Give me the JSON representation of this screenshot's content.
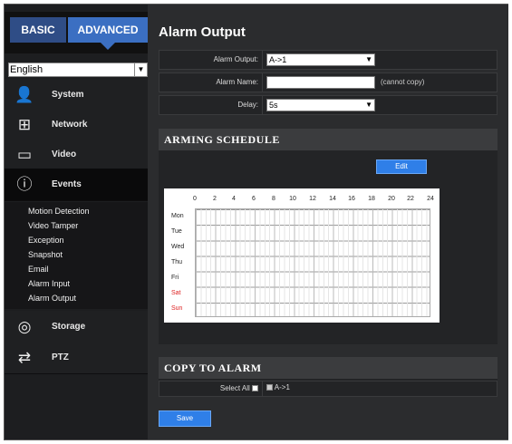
{
  "tabs": {
    "basic": "BASIC",
    "advanced": "ADVANCED"
  },
  "language": {
    "selected": "English"
  },
  "nav": {
    "system": "System",
    "network": "Network",
    "video": "Video",
    "events": "Events",
    "storage": "Storage",
    "ptz": "PTZ"
  },
  "events_submenu": [
    "Motion Detection",
    "Video Tamper",
    "Exception",
    "Snapshot",
    "Email",
    "Alarm Input",
    "Alarm Output"
  ],
  "page": {
    "title": "Alarm Output"
  },
  "form": {
    "alarm_output_label": "Alarm Output:",
    "alarm_output_value": "A->1",
    "alarm_name_label": "Alarm Name:",
    "alarm_name_value": "",
    "alarm_name_note": "(cannot copy)",
    "delay_label": "Delay:",
    "delay_value": "5s"
  },
  "schedule": {
    "title": "ARMING SCHEDULE",
    "edit_label": "Edit",
    "hours": [
      "0",
      "2",
      "4",
      "6",
      "8",
      "10",
      "12",
      "14",
      "16",
      "18",
      "20",
      "22",
      "24"
    ],
    "days": [
      "Mon",
      "Tue",
      "Wed",
      "Thu",
      "Fri",
      "Sat",
      "Sun"
    ]
  },
  "copy": {
    "title": "COPY TO ALARM",
    "select_all_label": "Select All",
    "target_label": "A->1"
  },
  "save_label": "Save",
  "colors": {
    "accent": "#3b6fc2",
    "button": "#2f7fe8",
    "weekend": "#d22222"
  }
}
